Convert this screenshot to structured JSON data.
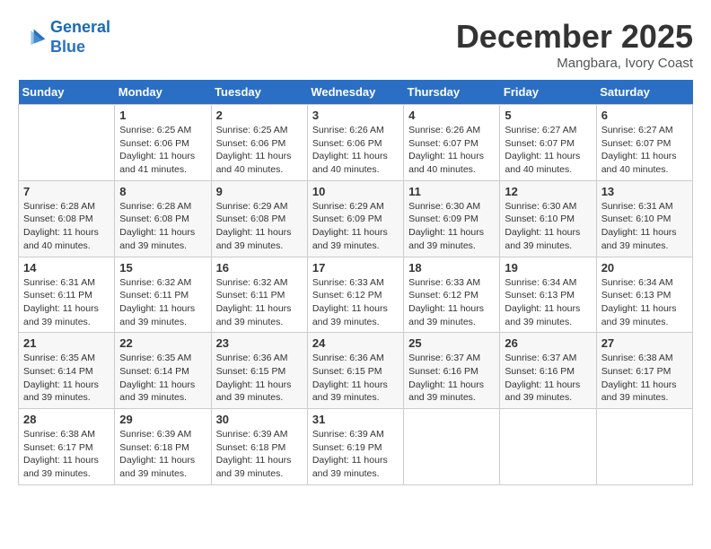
{
  "header": {
    "logo_line1": "General",
    "logo_line2": "Blue",
    "month": "December 2025",
    "location": "Mangbara, Ivory Coast"
  },
  "weekdays": [
    "Sunday",
    "Monday",
    "Tuesday",
    "Wednesday",
    "Thursday",
    "Friday",
    "Saturday"
  ],
  "weeks": [
    [
      {
        "day": "",
        "info": ""
      },
      {
        "day": "1",
        "info": "Sunrise: 6:25 AM\nSunset: 6:06 PM\nDaylight: 11 hours\nand 41 minutes."
      },
      {
        "day": "2",
        "info": "Sunrise: 6:25 AM\nSunset: 6:06 PM\nDaylight: 11 hours\nand 40 minutes."
      },
      {
        "day": "3",
        "info": "Sunrise: 6:26 AM\nSunset: 6:06 PM\nDaylight: 11 hours\nand 40 minutes."
      },
      {
        "day": "4",
        "info": "Sunrise: 6:26 AM\nSunset: 6:07 PM\nDaylight: 11 hours\nand 40 minutes."
      },
      {
        "day": "5",
        "info": "Sunrise: 6:27 AM\nSunset: 6:07 PM\nDaylight: 11 hours\nand 40 minutes."
      },
      {
        "day": "6",
        "info": "Sunrise: 6:27 AM\nSunset: 6:07 PM\nDaylight: 11 hours\nand 40 minutes."
      }
    ],
    [
      {
        "day": "7",
        "info": "Sunrise: 6:28 AM\nSunset: 6:08 PM\nDaylight: 11 hours\nand 40 minutes."
      },
      {
        "day": "8",
        "info": "Sunrise: 6:28 AM\nSunset: 6:08 PM\nDaylight: 11 hours\nand 39 minutes."
      },
      {
        "day": "9",
        "info": "Sunrise: 6:29 AM\nSunset: 6:08 PM\nDaylight: 11 hours\nand 39 minutes."
      },
      {
        "day": "10",
        "info": "Sunrise: 6:29 AM\nSunset: 6:09 PM\nDaylight: 11 hours\nand 39 minutes."
      },
      {
        "day": "11",
        "info": "Sunrise: 6:30 AM\nSunset: 6:09 PM\nDaylight: 11 hours\nand 39 minutes."
      },
      {
        "day": "12",
        "info": "Sunrise: 6:30 AM\nSunset: 6:10 PM\nDaylight: 11 hours\nand 39 minutes."
      },
      {
        "day": "13",
        "info": "Sunrise: 6:31 AM\nSunset: 6:10 PM\nDaylight: 11 hours\nand 39 minutes."
      }
    ],
    [
      {
        "day": "14",
        "info": "Sunrise: 6:31 AM\nSunset: 6:11 PM\nDaylight: 11 hours\nand 39 minutes."
      },
      {
        "day": "15",
        "info": "Sunrise: 6:32 AM\nSunset: 6:11 PM\nDaylight: 11 hours\nand 39 minutes."
      },
      {
        "day": "16",
        "info": "Sunrise: 6:32 AM\nSunset: 6:11 PM\nDaylight: 11 hours\nand 39 minutes."
      },
      {
        "day": "17",
        "info": "Sunrise: 6:33 AM\nSunset: 6:12 PM\nDaylight: 11 hours\nand 39 minutes."
      },
      {
        "day": "18",
        "info": "Sunrise: 6:33 AM\nSunset: 6:12 PM\nDaylight: 11 hours\nand 39 minutes."
      },
      {
        "day": "19",
        "info": "Sunrise: 6:34 AM\nSunset: 6:13 PM\nDaylight: 11 hours\nand 39 minutes."
      },
      {
        "day": "20",
        "info": "Sunrise: 6:34 AM\nSunset: 6:13 PM\nDaylight: 11 hours\nand 39 minutes."
      }
    ],
    [
      {
        "day": "21",
        "info": "Sunrise: 6:35 AM\nSunset: 6:14 PM\nDaylight: 11 hours\nand 39 minutes."
      },
      {
        "day": "22",
        "info": "Sunrise: 6:35 AM\nSunset: 6:14 PM\nDaylight: 11 hours\nand 39 minutes."
      },
      {
        "day": "23",
        "info": "Sunrise: 6:36 AM\nSunset: 6:15 PM\nDaylight: 11 hours\nand 39 minutes."
      },
      {
        "day": "24",
        "info": "Sunrise: 6:36 AM\nSunset: 6:15 PM\nDaylight: 11 hours\nand 39 minutes."
      },
      {
        "day": "25",
        "info": "Sunrise: 6:37 AM\nSunset: 6:16 PM\nDaylight: 11 hours\nand 39 minutes."
      },
      {
        "day": "26",
        "info": "Sunrise: 6:37 AM\nSunset: 6:16 PM\nDaylight: 11 hours\nand 39 minutes."
      },
      {
        "day": "27",
        "info": "Sunrise: 6:38 AM\nSunset: 6:17 PM\nDaylight: 11 hours\nand 39 minutes."
      }
    ],
    [
      {
        "day": "28",
        "info": "Sunrise: 6:38 AM\nSunset: 6:17 PM\nDaylight: 11 hours\nand 39 minutes."
      },
      {
        "day": "29",
        "info": "Sunrise: 6:39 AM\nSunset: 6:18 PM\nDaylight: 11 hours\nand 39 minutes."
      },
      {
        "day": "30",
        "info": "Sunrise: 6:39 AM\nSunset: 6:18 PM\nDaylight: 11 hours\nand 39 minutes."
      },
      {
        "day": "31",
        "info": "Sunrise: 6:39 AM\nSunset: 6:19 PM\nDaylight: 11 hours\nand 39 minutes."
      },
      {
        "day": "",
        "info": ""
      },
      {
        "day": "",
        "info": ""
      },
      {
        "day": "",
        "info": ""
      }
    ]
  ]
}
